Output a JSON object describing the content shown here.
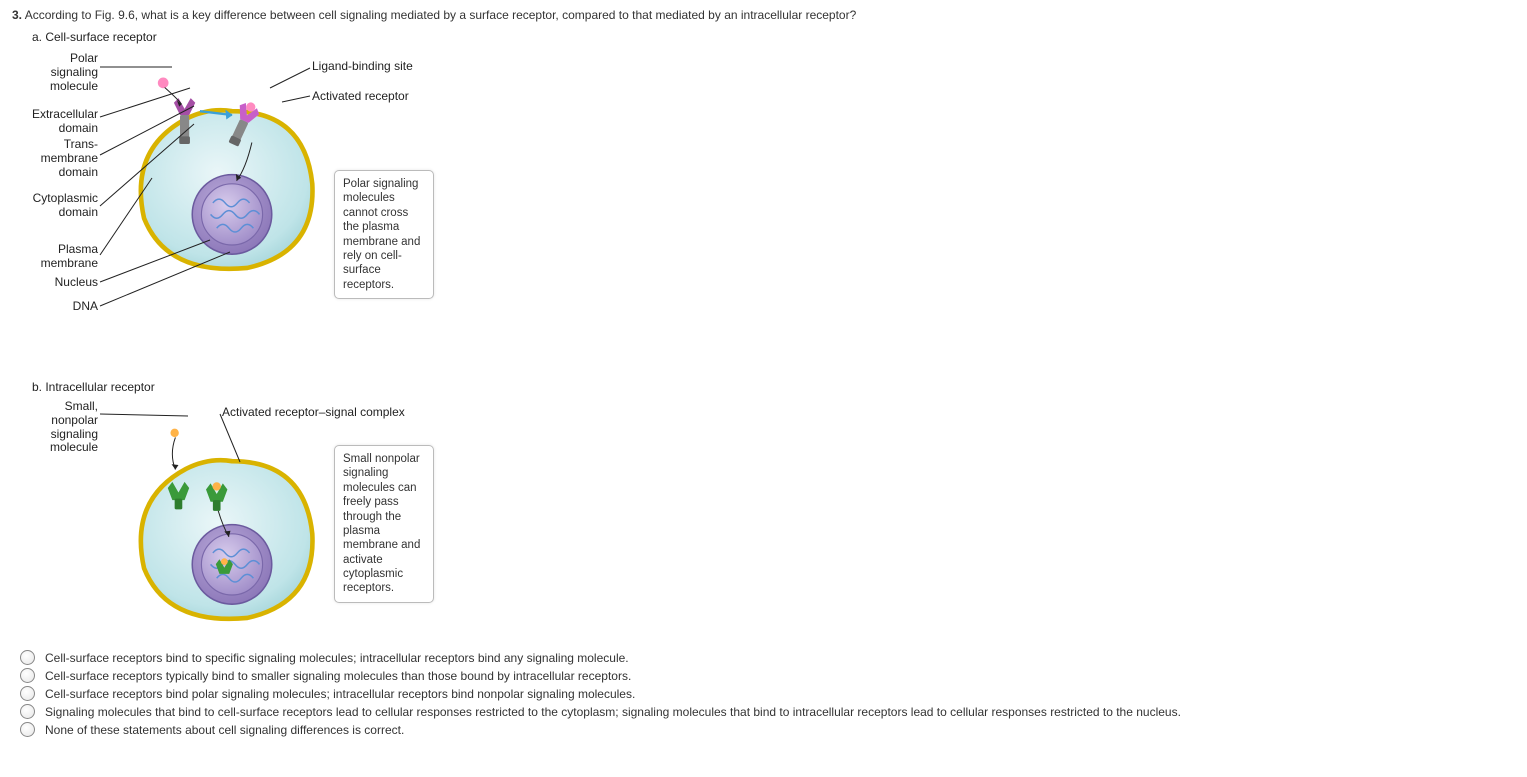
{
  "question": {
    "number": "3.",
    "text": "According to Fig. 9.6, what is a key difference between cell signaling mediated by a surface receptor, compared to that mediated by an intracellular receptor?"
  },
  "figure": {
    "panel_a": {
      "title": "a. Cell-surface receptor",
      "labels": {
        "polar_signaling_molecule": "Polar\nsignaling\nmolecule",
        "extracellular_domain": "Extracellular\ndomain",
        "trans_membrane_domain": "Trans-\nmembrane\ndomain",
        "cytoplasmic_domain": "Cytoplasmic\ndomain",
        "plasma_membrane": "Plasma\nmembrane",
        "nucleus": "Nucleus",
        "dna": "DNA",
        "ligand_binding_site": "Ligand-binding site",
        "activated_receptor": "Activated receptor"
      },
      "note": "Polar signaling molecules cannot cross the plasma membrane and rely on cell-surface receptors."
    },
    "panel_b": {
      "title": "b. Intracellular receptor",
      "labels": {
        "small_nonpolar": "Small,\nnonpolar\nsignaling\nmolecule",
        "activated_complex": "Activated receptor–signal complex"
      },
      "note": "Small nonpolar signaling molecules can freely pass through the plasma membrane and activate cytoplasmic receptors."
    }
  },
  "options": [
    "Cell-surface receptors bind to specific signaling molecules; intracellular receptors bind any signaling molecule.",
    "Cell-surface receptors typically bind to smaller signaling molecules than those bound by intracellular receptors.",
    "Cell-surface receptors bind polar signaling molecules; intracellular receptors bind nonpolar signaling molecules.",
    "Signaling molecules that bind to cell-surface receptors lead to cellular responses restricted to the cytoplasm; signaling molecules that bind to intracellular receptors lead to cellular responses restricted to the nucleus.",
    "None of these statements about cell signaling differences is correct."
  ]
}
